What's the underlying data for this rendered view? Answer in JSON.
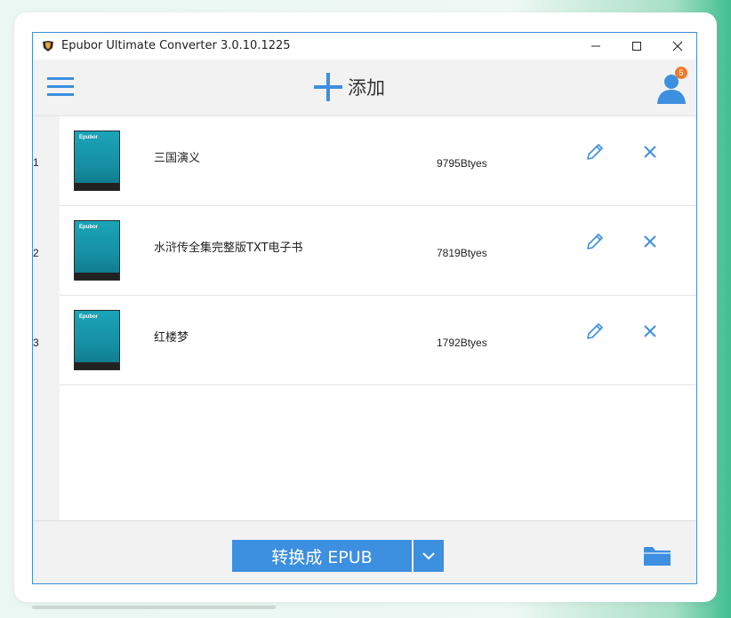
{
  "window": {
    "title": "Epubor Ultimate Converter 3.0.10.1225"
  },
  "toolbar": {
    "add_label": "添加",
    "user_badge": "5"
  },
  "books": [
    {
      "index": "1",
      "title": "三国演义",
      "size": "9795Btyes",
      "cover_brand": "Epubor"
    },
    {
      "index": "2",
      "title": "水浒传全集完整版TXT电子书",
      "size": "7819Btyes",
      "cover_brand": "Epubor"
    },
    {
      "index": "3",
      "title": "红楼梦",
      "size": "1792Btyes",
      "cover_brand": "Epubor"
    }
  ],
  "footer": {
    "convert_label": "转换成 EPUB"
  },
  "colors": {
    "accent": "#3d8fe0",
    "window_border": "#3f8fd8",
    "badge": "#f07a2c",
    "cover": "#168ea2"
  },
  "icons": [
    "app-logo-icon",
    "minimize-icon",
    "maximize-icon",
    "close-window-icon",
    "hamburger-menu-icon",
    "plus-icon",
    "user-icon",
    "book-cover",
    "pencil-icon",
    "delete-icon",
    "chevron-down-icon",
    "folder-icon"
  ]
}
